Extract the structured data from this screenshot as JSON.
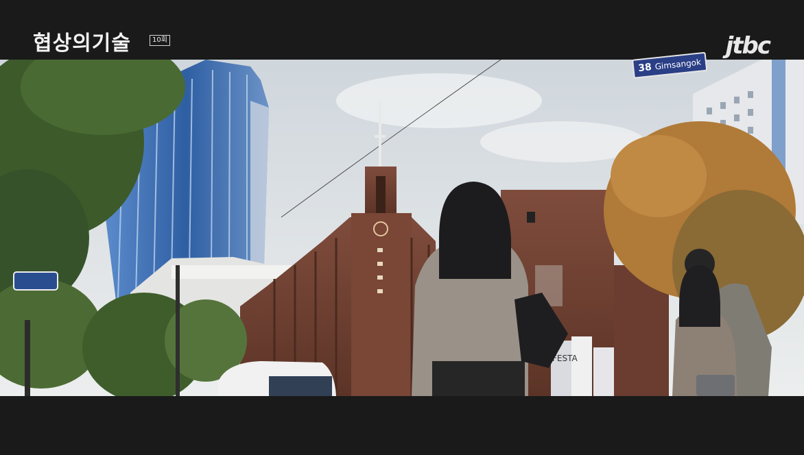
{
  "broadcast": {
    "show_title": "협상의기술",
    "episode": "10회",
    "network": "jtbc"
  },
  "street_sign": {
    "number": "38",
    "name": "Gimsangok"
  },
  "church_sign": "",
  "poster_text": "FESTA",
  "colors": {
    "sky": "#dfe3e6",
    "brick": "#7a4a3b",
    "glass_tower": "#3a6fb5",
    "sign_blue": "#2a3f86"
  }
}
